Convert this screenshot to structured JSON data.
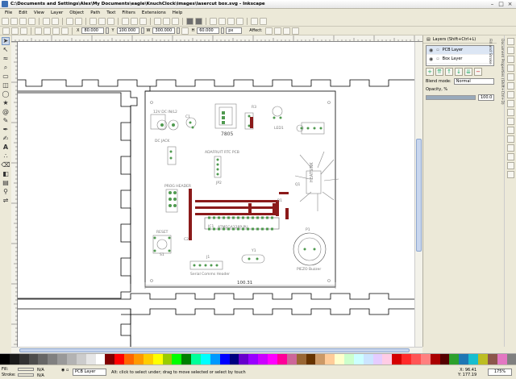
{
  "window": {
    "title": "C:\\Documents and Settings\\Alex\\My Documents\\eagle\\KnuchClock\\images\\lasercut box.svg - Inkscape"
  },
  "menu": [
    "File",
    "Edit",
    "View",
    "Layer",
    "Object",
    "Path",
    "Text",
    "Filters",
    "Extensions",
    "Help"
  ],
  "controls": {
    "x_label": "X",
    "x_value": "80.000",
    "y_label": "Y",
    "y_value": "100.000",
    "w_label": "W",
    "w_value": "300.000",
    "h_label": "H",
    "h_value": "60.000",
    "units": "px",
    "affect_label": "Affect:"
  },
  "layers_panel": {
    "header": "Layers (Shift+Ctrl+L)",
    "layers": [
      {
        "name": "PCB Layer",
        "selected": true
      },
      {
        "name": "Box Layer",
        "selected": false
      }
    ],
    "blend_label": "Blend mode:",
    "blend_value": "Normal",
    "opacity_label": "Opacity, %",
    "opacity_value": "100.0",
    "opacity_fraction": 1.0
  },
  "side_tabs": [
    "Document Properties (Shift+Ctrl+D)",
    "Fill and Stroke"
  ],
  "canvas": {
    "labels": {
      "lcd_title": "12V DC IN/L2",
      "power_jack": "DC JACK",
      "reg_label": "7805",
      "fuse_label": "R3",
      "led_label": "LED1",
      "rtc_title": "ADAFRUIT RTC PCB",
      "jp_label": "JP2",
      "prog_header": "PROG HEADER",
      "heatsink": "HEATSINK",
      "chip_label": "ATMEGA328P-PU",
      "ic_label": "IC1",
      "reset": "RESET",
      "serial": "Serial Comms Header",
      "crystal": "Y1",
      "piezo": "PIEZO Buzzer",
      "piezo_ref": "P1",
      "dimension": "100.31",
      "q1": "Q1",
      "c1": "C1",
      "c2": "C2",
      "r1": "R1",
      "sw1": "S1",
      "j1": "J1"
    }
  },
  "palette": [
    "#000000",
    "#1a1a1a",
    "#333333",
    "#4d4d4d",
    "#666666",
    "#808080",
    "#999999",
    "#b3b3b3",
    "#cccccc",
    "#e6e6e6",
    "#ffffff",
    "#800000",
    "#ff0000",
    "#ff6600",
    "#ff9900",
    "#ffcc00",
    "#ffff00",
    "#99cc00",
    "#00ff00",
    "#008000",
    "#00ff99",
    "#00ffff",
    "#0099ff",
    "#0000ff",
    "#000080",
    "#6600cc",
    "#9900ff",
    "#cc00ff",
    "#ff00ff",
    "#ff0099",
    "#cc6699",
    "#996633",
    "#663300",
    "#cc9966",
    "#ffcc99",
    "#ffffcc",
    "#ccffcc",
    "#ccffff",
    "#cce5ff",
    "#e5ccff",
    "#ffcce5",
    "#d40000",
    "#ff2a2a",
    "#ff5555",
    "#ff8080",
    "#aa0000",
    "#550000",
    "#2ca02c",
    "#1f77b4",
    "#17becf",
    "#bcbd22",
    "#8c564b",
    "#e377c2",
    "#7f7f7f"
  ],
  "status": {
    "fill_label": "Fill:",
    "stroke_label": "Stroke:",
    "fill_value": "N/A",
    "stroke_value": "N/A",
    "layer": "PCB Layer",
    "message": "Alt: click to select under; drag to move selected or select by touch",
    "x": "X: 96.41",
    "y": "Y: 177.19",
    "zoom": "175%"
  }
}
